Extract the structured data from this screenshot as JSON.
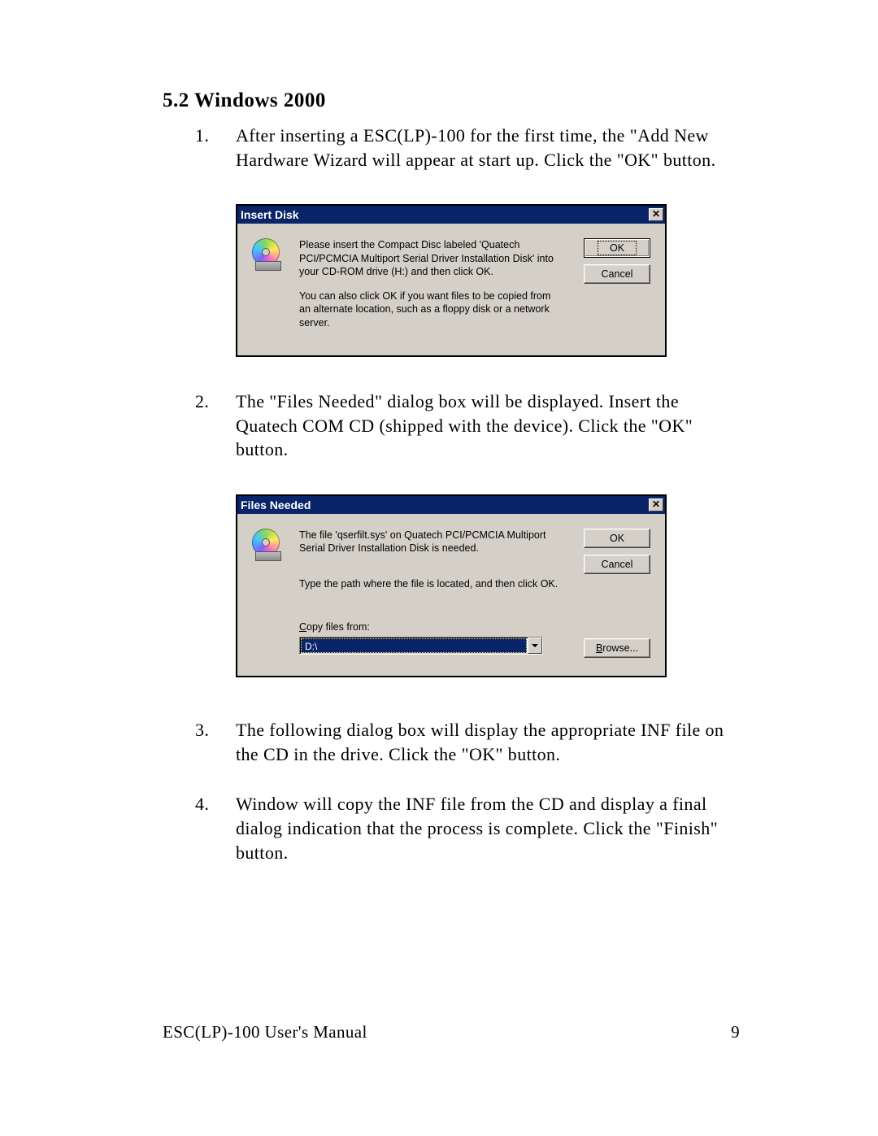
{
  "section_heading": "5.2  Windows 2000",
  "steps": [
    {
      "num": "1.",
      "text": "After inserting a ESC(LP)-100 for the first time, the \"Add New Hardware Wizard will appear at start up. Click the \"OK\" button."
    },
    {
      "num": "2.",
      "text": "The \"Files Needed\" dialog box will be displayed.   Insert the Quatech     COM CD (shipped with the device). Click the \"OK\" button."
    },
    {
      "num": "3.",
      "text": "The following dialog box will display the appropriate INF file on the CD in the drive. Click the \"OK\" button."
    },
    {
      "num": "4.",
      "text": "Window will copy the INF file from the CD and display a final dialog indication that the process is complete. Click the \"Finish\" button."
    }
  ],
  "dialog1": {
    "title": "Insert Disk",
    "close_glyph": "✕",
    "para1": "Please insert the Compact Disc labeled 'Quatech PCI/PCMCIA Multiport Serial Driver Installation Disk' into your CD-ROM drive (H:) and then click OK.",
    "para2": "You can also click OK if you want files to be copied from an alternate location, such as a floppy disk or a network server.",
    "ok": "OK",
    "cancel": "Cancel"
  },
  "dialog2": {
    "title": "Files Needed",
    "close_glyph": "✕",
    "para1": "The file 'qserfilt.sys' on Quatech PCI/PCMCIA Multiport Serial Driver Installation Disk is needed.",
    "para2": "Type the path where the file is located, and then click OK.",
    "copy_label_pre": "C",
    "copy_label_rest": "opy files from:",
    "combo_value": "D:\\",
    "ok": "OK",
    "cancel": "Cancel",
    "browse_pre": "B",
    "browse_rest": "rowse..."
  },
  "footer_left": "ESC(LP)-100 User's Manual",
  "footer_right": "9"
}
